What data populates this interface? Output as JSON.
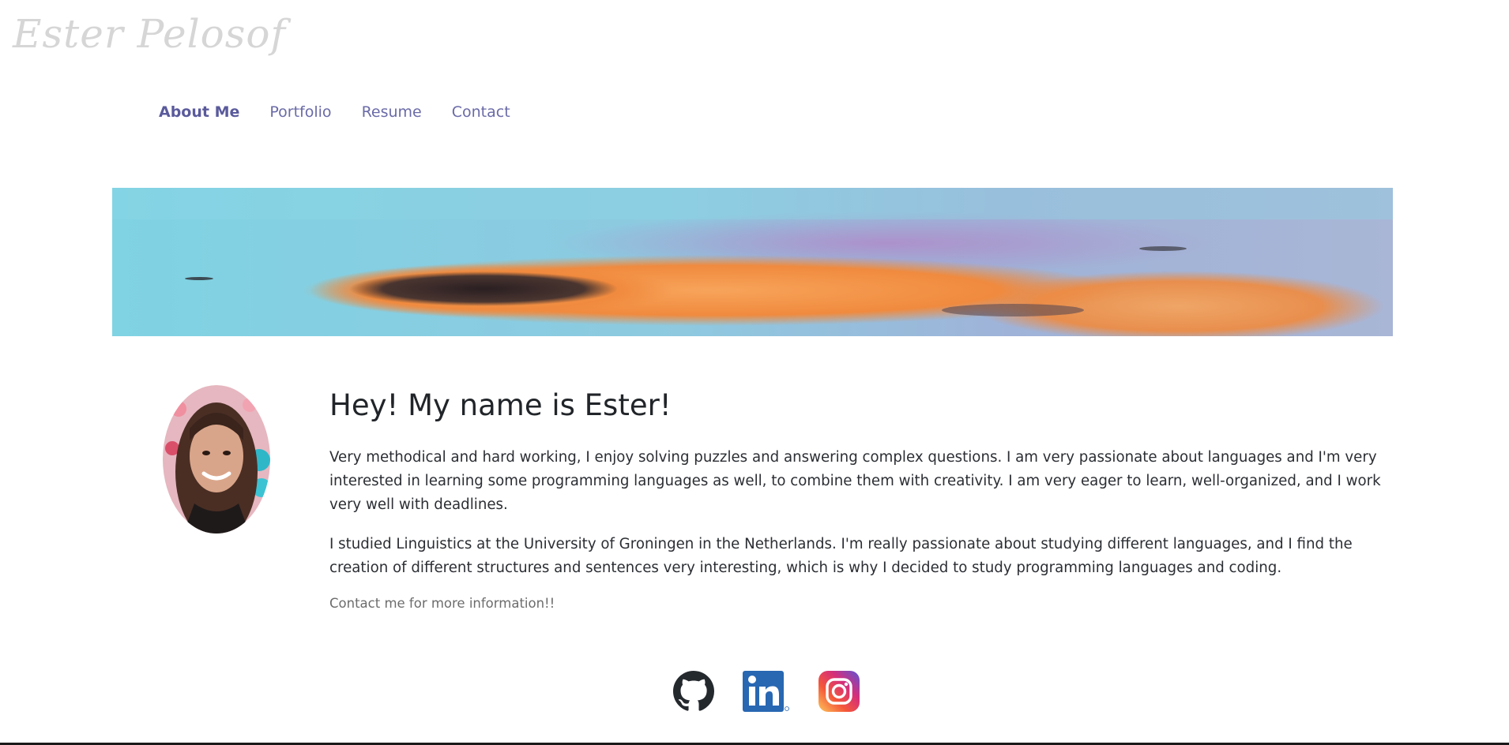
{
  "brand": {
    "name": "Ester Pelosof"
  },
  "nav": {
    "items": [
      {
        "label": "About Me",
        "active": true
      },
      {
        "label": "Portfolio",
        "active": false
      },
      {
        "label": "Resume",
        "active": false
      },
      {
        "label": "Contact",
        "active": false
      }
    ]
  },
  "about": {
    "heading": "Hey! My name is Ester!",
    "paragraphs": [
      "Very methodical and hard working, I enjoy solving puzzles and answering complex questions. I am very passionate about languages and I'm very interested in learning some programming languages as well, to combine them with creativity. I am very eager to learn, well-organized, and I work very well with deadlines.",
      "I studied Linguistics at the University of Groningen in the Netherlands. I'm really passionate about studying different languages, and I find the creation of different structures and sentences very interesting, which is why I decided to study programming languages and coding."
    ],
    "note": "Contact me for more information!!"
  },
  "social": [
    {
      "icon": "github-icon"
    },
    {
      "icon": "linkedin-icon"
    },
    {
      "icon": "instagram-icon"
    }
  ],
  "colors": {
    "nav": "#6a6aa8",
    "brand": "#d6d6d6",
    "heading": "#212529",
    "linkedin": "#2867b2"
  }
}
